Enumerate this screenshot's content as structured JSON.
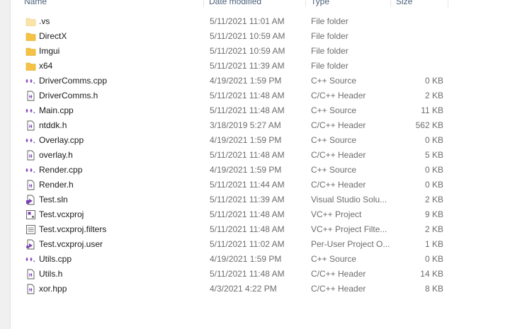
{
  "columns": {
    "name": "Name",
    "date": "Date modified",
    "type": "Type",
    "size": "Size"
  },
  "files": [
    {
      "name": ".vs",
      "date": "5/11/2021 11:01 AM",
      "type": "File folder",
      "size": "",
      "icon": "folder-icon-light"
    },
    {
      "name": "DirectX",
      "date": "5/11/2021 10:59 AM",
      "type": "File folder",
      "size": "",
      "icon": "folder-icon"
    },
    {
      "name": "Imgui",
      "date": "5/11/2021 10:59 AM",
      "type": "File folder",
      "size": "",
      "icon": "folder-icon"
    },
    {
      "name": "x64",
      "date": "5/11/2021 11:39 AM",
      "type": "File folder",
      "size": "",
      "icon": "folder-icon"
    },
    {
      "name": "DriverComms.cpp",
      "date": "4/19/2021 1:59 PM",
      "type": "C++ Source",
      "size": "0 KB",
      "icon": "cpp-file-icon"
    },
    {
      "name": "DriverComms.h",
      "date": "5/11/2021 11:48 AM",
      "type": "C/C++ Header",
      "size": "2 KB",
      "icon": "header-file-icon"
    },
    {
      "name": "Main.cpp",
      "date": "5/11/2021 11:48 AM",
      "type": "C++ Source",
      "size": "11 KB",
      "icon": "cpp-file-icon"
    },
    {
      "name": "ntddk.h",
      "date": "3/18/2019 5:27 AM",
      "type": "C/C++ Header",
      "size": "562 KB",
      "icon": "header-file-icon"
    },
    {
      "name": "Overlay.cpp",
      "date": "4/19/2021 1:59 PM",
      "type": "C++ Source",
      "size": "0 KB",
      "icon": "cpp-file-icon"
    },
    {
      "name": "overlay.h",
      "date": "5/11/2021 11:48 AM",
      "type": "C/C++ Header",
      "size": "5 KB",
      "icon": "header-file-icon"
    },
    {
      "name": "Render.cpp",
      "date": "4/19/2021 1:59 PM",
      "type": "C++ Source",
      "size": "0 KB",
      "icon": "cpp-file-icon"
    },
    {
      "name": "Render.h",
      "date": "5/11/2021 11:44 AM",
      "type": "C/C++ Header",
      "size": "0 KB",
      "icon": "header-file-icon"
    },
    {
      "name": "Test.sln",
      "date": "5/11/2021 11:39 AM",
      "type": "Visual Studio Solu...",
      "size": "2 KB",
      "icon": "solution-file-icon"
    },
    {
      "name": "Test.vcxproj",
      "date": "5/11/2021 11:48 AM",
      "type": "VC++ Project",
      "size": "9 KB",
      "icon": "project-file-icon"
    },
    {
      "name": "Test.vcxproj.filters",
      "date": "5/11/2021 11:48 AM",
      "type": "VC++ Project Filte...",
      "size": "2 KB",
      "icon": "filters-file-icon"
    },
    {
      "name": "Test.vcxproj.user",
      "date": "5/11/2021 11:02 AM",
      "type": "Per-User Project O...",
      "size": "1 KB",
      "icon": "user-project-file-icon"
    },
    {
      "name": "Utils.cpp",
      "date": "4/19/2021 1:59 PM",
      "type": "C++ Source",
      "size": "0 KB",
      "icon": "cpp-file-icon"
    },
    {
      "name": "Utils.h",
      "date": "5/11/2021 11:48 AM",
      "type": "C/C++ Header",
      "size": "14 KB",
      "icon": "header-file-icon"
    },
    {
      "name": "xor.hpp",
      "date": "4/3/2021 4:22 PM",
      "type": "C/C++ Header",
      "size": "8 KB",
      "icon": "header-file-icon"
    }
  ],
  "colors": {
    "folder": "#f5c242",
    "folder_light": "#fbe4a6",
    "cpp_purple": "#7a3fb0",
    "text": "#1a1a1a",
    "muted": "#6d6d6d",
    "header_text": "#4c607a"
  }
}
